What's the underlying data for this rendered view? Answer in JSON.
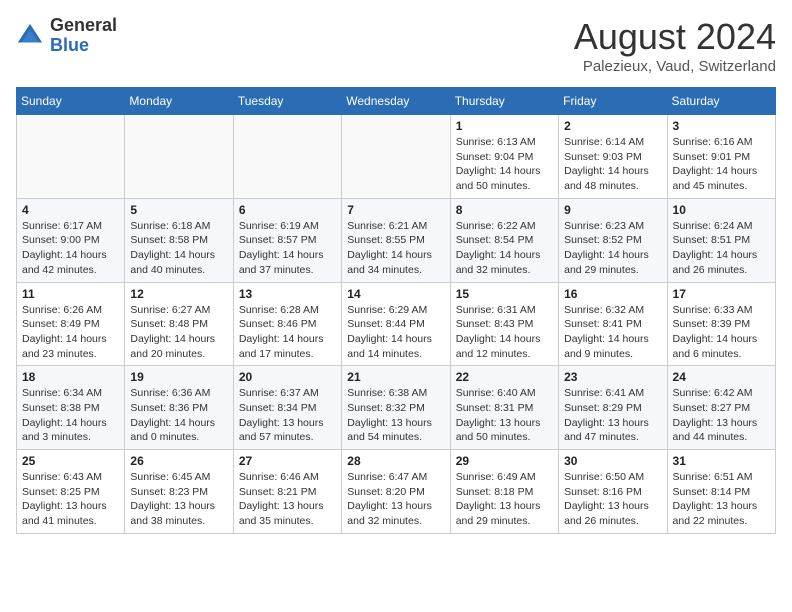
{
  "header": {
    "logo_general": "General",
    "logo_blue": "Blue",
    "month": "August 2024",
    "location": "Palezieux, Vaud, Switzerland"
  },
  "weekdays": [
    "Sunday",
    "Monday",
    "Tuesday",
    "Wednesday",
    "Thursday",
    "Friday",
    "Saturday"
  ],
  "weeks": [
    [
      {
        "day": "",
        "info": ""
      },
      {
        "day": "",
        "info": ""
      },
      {
        "day": "",
        "info": ""
      },
      {
        "day": "",
        "info": ""
      },
      {
        "day": "1",
        "info": "Sunrise: 6:13 AM\nSunset: 9:04 PM\nDaylight: 14 hours\nand 50 minutes."
      },
      {
        "day": "2",
        "info": "Sunrise: 6:14 AM\nSunset: 9:03 PM\nDaylight: 14 hours\nand 48 minutes."
      },
      {
        "day": "3",
        "info": "Sunrise: 6:16 AM\nSunset: 9:01 PM\nDaylight: 14 hours\nand 45 minutes."
      }
    ],
    [
      {
        "day": "4",
        "info": "Sunrise: 6:17 AM\nSunset: 9:00 PM\nDaylight: 14 hours\nand 42 minutes."
      },
      {
        "day": "5",
        "info": "Sunrise: 6:18 AM\nSunset: 8:58 PM\nDaylight: 14 hours\nand 40 minutes."
      },
      {
        "day": "6",
        "info": "Sunrise: 6:19 AM\nSunset: 8:57 PM\nDaylight: 14 hours\nand 37 minutes."
      },
      {
        "day": "7",
        "info": "Sunrise: 6:21 AM\nSunset: 8:55 PM\nDaylight: 14 hours\nand 34 minutes."
      },
      {
        "day": "8",
        "info": "Sunrise: 6:22 AM\nSunset: 8:54 PM\nDaylight: 14 hours\nand 32 minutes."
      },
      {
        "day": "9",
        "info": "Sunrise: 6:23 AM\nSunset: 8:52 PM\nDaylight: 14 hours\nand 29 minutes."
      },
      {
        "day": "10",
        "info": "Sunrise: 6:24 AM\nSunset: 8:51 PM\nDaylight: 14 hours\nand 26 minutes."
      }
    ],
    [
      {
        "day": "11",
        "info": "Sunrise: 6:26 AM\nSunset: 8:49 PM\nDaylight: 14 hours\nand 23 minutes."
      },
      {
        "day": "12",
        "info": "Sunrise: 6:27 AM\nSunset: 8:48 PM\nDaylight: 14 hours\nand 20 minutes."
      },
      {
        "day": "13",
        "info": "Sunrise: 6:28 AM\nSunset: 8:46 PM\nDaylight: 14 hours\nand 17 minutes."
      },
      {
        "day": "14",
        "info": "Sunrise: 6:29 AM\nSunset: 8:44 PM\nDaylight: 14 hours\nand 14 minutes."
      },
      {
        "day": "15",
        "info": "Sunrise: 6:31 AM\nSunset: 8:43 PM\nDaylight: 14 hours\nand 12 minutes."
      },
      {
        "day": "16",
        "info": "Sunrise: 6:32 AM\nSunset: 8:41 PM\nDaylight: 14 hours\nand 9 minutes."
      },
      {
        "day": "17",
        "info": "Sunrise: 6:33 AM\nSunset: 8:39 PM\nDaylight: 14 hours\nand 6 minutes."
      }
    ],
    [
      {
        "day": "18",
        "info": "Sunrise: 6:34 AM\nSunset: 8:38 PM\nDaylight: 14 hours\nand 3 minutes."
      },
      {
        "day": "19",
        "info": "Sunrise: 6:36 AM\nSunset: 8:36 PM\nDaylight: 14 hours\nand 0 minutes."
      },
      {
        "day": "20",
        "info": "Sunrise: 6:37 AM\nSunset: 8:34 PM\nDaylight: 13 hours\nand 57 minutes."
      },
      {
        "day": "21",
        "info": "Sunrise: 6:38 AM\nSunset: 8:32 PM\nDaylight: 13 hours\nand 54 minutes."
      },
      {
        "day": "22",
        "info": "Sunrise: 6:40 AM\nSunset: 8:31 PM\nDaylight: 13 hours\nand 50 minutes."
      },
      {
        "day": "23",
        "info": "Sunrise: 6:41 AM\nSunset: 8:29 PM\nDaylight: 13 hours\nand 47 minutes."
      },
      {
        "day": "24",
        "info": "Sunrise: 6:42 AM\nSunset: 8:27 PM\nDaylight: 13 hours\nand 44 minutes."
      }
    ],
    [
      {
        "day": "25",
        "info": "Sunrise: 6:43 AM\nSunset: 8:25 PM\nDaylight: 13 hours\nand 41 minutes."
      },
      {
        "day": "26",
        "info": "Sunrise: 6:45 AM\nSunset: 8:23 PM\nDaylight: 13 hours\nand 38 minutes."
      },
      {
        "day": "27",
        "info": "Sunrise: 6:46 AM\nSunset: 8:21 PM\nDaylight: 13 hours\nand 35 minutes."
      },
      {
        "day": "28",
        "info": "Sunrise: 6:47 AM\nSunset: 8:20 PM\nDaylight: 13 hours\nand 32 minutes."
      },
      {
        "day": "29",
        "info": "Sunrise: 6:49 AM\nSunset: 8:18 PM\nDaylight: 13 hours\nand 29 minutes."
      },
      {
        "day": "30",
        "info": "Sunrise: 6:50 AM\nSunset: 8:16 PM\nDaylight: 13 hours\nand 26 minutes."
      },
      {
        "day": "31",
        "info": "Sunrise: 6:51 AM\nSunset: 8:14 PM\nDaylight: 13 hours\nand 22 minutes."
      }
    ]
  ]
}
